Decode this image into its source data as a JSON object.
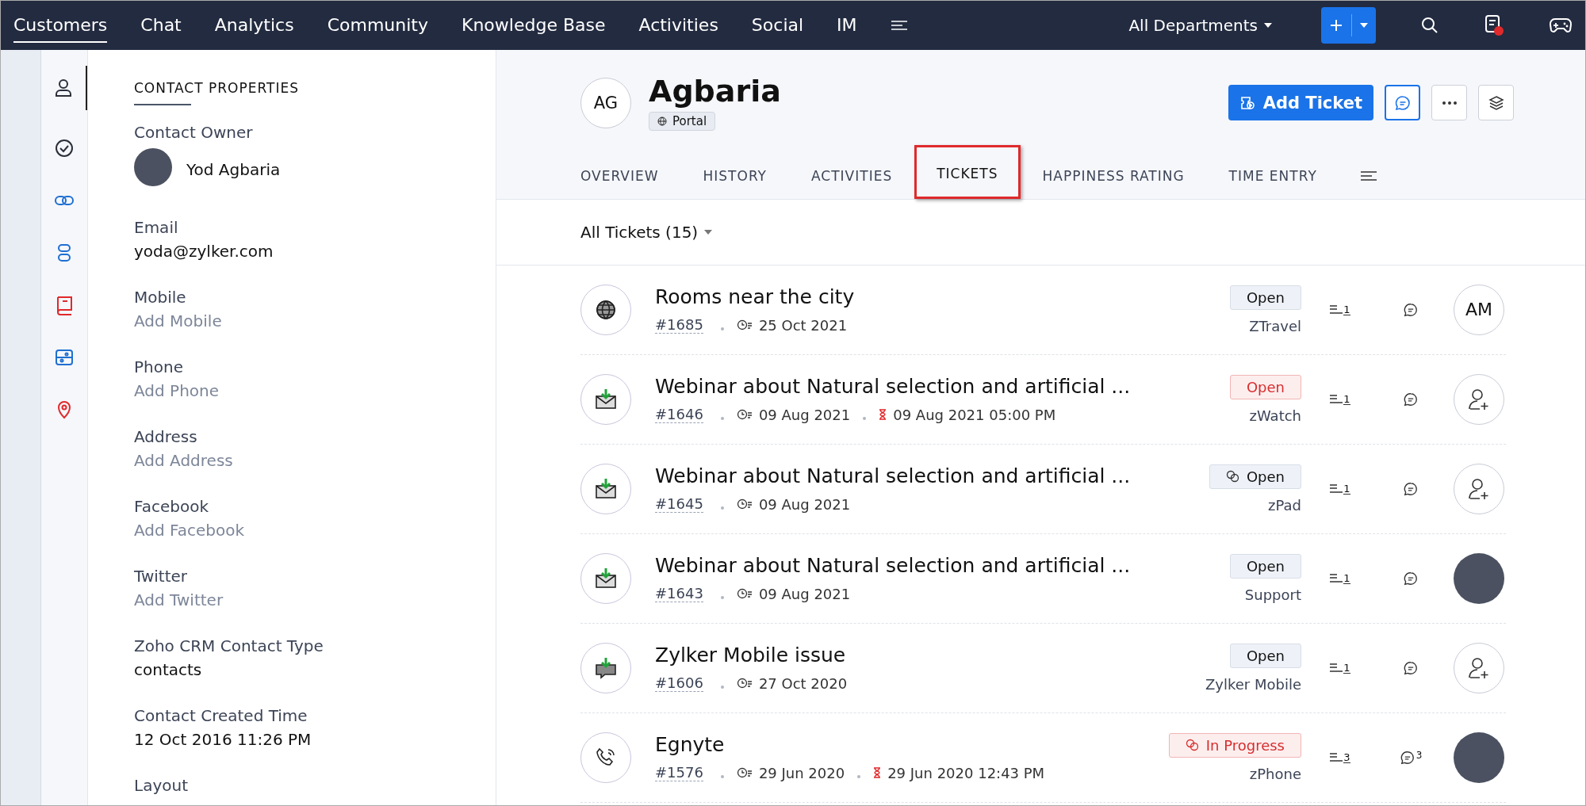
{
  "top_nav": {
    "tabs": [
      {
        "label": "Customers",
        "selected": true
      },
      {
        "label": "Chat",
        "selected": false
      },
      {
        "label": "Analytics",
        "selected": false
      },
      {
        "label": "Community",
        "selected": false
      },
      {
        "label": "Knowledge Base",
        "selected": false
      },
      {
        "label": "Activities",
        "selected": false
      },
      {
        "label": "Social",
        "selected": false
      },
      {
        "label": "IM",
        "selected": false
      }
    ],
    "department": "All Departments",
    "notification_alert": true
  },
  "side_rail": [
    {
      "kind": "person",
      "selected": true,
      "color": "#2b2f3a"
    },
    {
      "kind": "check",
      "selected": false,
      "color": "#2b2f3a"
    },
    {
      "kind": "links",
      "selected": false,
      "color": "#1f6fd1"
    },
    {
      "kind": "blocks",
      "selected": false,
      "color": "#1f6fd1"
    },
    {
      "kind": "book",
      "selected": false,
      "color": "#e0292b"
    },
    {
      "kind": "card",
      "selected": false,
      "color": "#1f6fd1"
    },
    {
      "kind": "pin",
      "selected": false,
      "color": "#e0292b"
    }
  ],
  "contact_properties": {
    "heading": "CONTACT PROPERTIES",
    "fields": [
      {
        "kind": "owner",
        "label": "Contact Owner",
        "value": "Yod Agbaria"
      },
      {
        "kind": "value",
        "label": "Email",
        "value": "yoda@zylker.com"
      },
      {
        "kind": "empty",
        "label": "Mobile",
        "value": "Add Mobile"
      },
      {
        "kind": "empty",
        "label": "Phone",
        "value": "Add Phone"
      },
      {
        "kind": "empty",
        "label": "Address",
        "value": "Add Address"
      },
      {
        "kind": "empty",
        "label": "Facebook",
        "value": "Add Facebook"
      },
      {
        "kind": "empty",
        "label": "Twitter",
        "value": "Add Twitter"
      },
      {
        "kind": "value",
        "label": "Zoho CRM Contact Type",
        "value": "contacts"
      },
      {
        "kind": "value",
        "label": "Contact Created Time",
        "value": "12 Oct 2016 11:26 PM"
      },
      {
        "kind": "heading",
        "label": "Layout"
      }
    ]
  },
  "contact": {
    "initials": "AG",
    "name": "Agbaria",
    "badge": "Portal"
  },
  "actions": {
    "add_ticket": "Add Ticket"
  },
  "tabs": [
    {
      "label": "OVERVIEW",
      "selected": false,
      "highlighted": false
    },
    {
      "label": "HISTORY",
      "selected": false,
      "highlighted": false
    },
    {
      "label": "ACTIVITIES",
      "selected": false,
      "highlighted": false
    },
    {
      "label": "TICKETS",
      "selected": true,
      "highlighted": true
    },
    {
      "label": "HAPPINESS RATING",
      "selected": false,
      "highlighted": false
    },
    {
      "label": "TIME ENTRY",
      "selected": false,
      "highlighted": false
    }
  ],
  "filter": "All Tickets (15)",
  "tickets": [
    {
      "kind": "web",
      "title": "Rooms near the city",
      "number": "#1685",
      "created": "25 Oct 2021",
      "status": "Open",
      "overdue": false,
      "status_icon": false,
      "department": "ZTravel",
      "threads": "1",
      "assignee": {
        "kind": "initials",
        "initials": "AM"
      }
    },
    {
      "kind": "email",
      "title": "Webinar about Natural selection and artificial ...",
      "number": "#1646",
      "created": "09 Aug 2021",
      "due": "09 Aug 2021 05:00 PM",
      "status": "Open",
      "overdue": true,
      "status_icon": false,
      "department": "zWatch",
      "threads": "1",
      "assignee": {
        "kind": "unassigned"
      }
    },
    {
      "kind": "email",
      "title": "Webinar about Natural selection and artificial ...",
      "number": "#1645",
      "created": "09 Aug 2021",
      "status": "Open",
      "overdue": false,
      "status_icon": true,
      "department": "zPad",
      "threads": "1",
      "assignee": {
        "kind": "unassigned"
      }
    },
    {
      "kind": "email",
      "title": "Webinar about Natural selection and artificial ...",
      "number": "#1643",
      "created": "09 Aug 2021",
      "status": "Open",
      "overdue": false,
      "status_icon": false,
      "department": "Support",
      "threads": "1",
      "assignee": {
        "kind": "photo"
      }
    },
    {
      "kind": "chat",
      "title": "Zylker Mobile issue",
      "number": "#1606",
      "created": "27 Oct 2020",
      "status": "Open",
      "overdue": false,
      "status_icon": false,
      "department": "Zylker Mobile",
      "threads": "1",
      "assignee": {
        "kind": "unassigned"
      }
    },
    {
      "kind": "phone",
      "title": "Egnyte",
      "number": "#1576",
      "created": "29 Jun 2020",
      "due": "29 Jun 2020 12:43 PM",
      "status": "In Progress",
      "overdue": true,
      "status_icon": true,
      "department": "zPhone",
      "threads": "3",
      "comments": "3",
      "assignee": {
        "kind": "photo"
      }
    }
  ]
}
